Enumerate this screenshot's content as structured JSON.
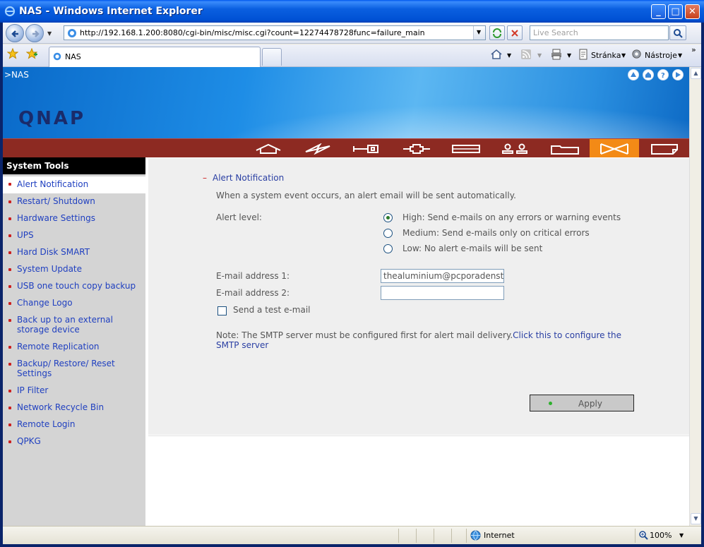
{
  "window": {
    "title": "NAS - Windows Internet Explorer"
  },
  "browser": {
    "url": "http://192.168.1.200:8080/cgi-bin/misc/misc.cgi?count=12274478728func=failure_main",
    "search_placeholder": "Live Search",
    "tab_title": "NAS",
    "page_menu": "Stránka",
    "tools_menu": "Nástroje"
  },
  "banner": {
    "breadcrumb": ">NAS",
    "logo": "QNAP"
  },
  "sidebar": {
    "title": "System Tools",
    "items": [
      "Alert Notification",
      "Restart/ Shutdown",
      "Hardware Settings",
      "UPS",
      "Hard Disk SMART",
      "System Update",
      "USB one touch copy backup",
      "Change Logo",
      "Back up to an external storage device",
      "Remote Replication",
      "Backup/ Restore/ Reset Settings",
      "IP Filter",
      "Network Recycle Bin",
      "Remote Login",
      "QPKG"
    ],
    "active_index": 0
  },
  "form": {
    "section_title": "Alert Notification",
    "description": "When a system event occurs, an alert email will be sent automatically.",
    "alert_level_label": "Alert level:",
    "alert_options": [
      "High: Send e-mails on any errors or warning events",
      "Medium: Send e-mails only on critical errors",
      "Low: No alert e-mails will be sent"
    ],
    "selected_alert": 0,
    "email1_label": "E-mail address 1:",
    "email1_value": "thealuminium@pcporadenstvi.c",
    "email2_label": "E-mail address 2:",
    "email2_value": "",
    "test_email_label": "Send a test e-mail",
    "note_text": "Note: The SMTP server must be configured first for alert mail delivery.",
    "note_link": "Click this to configure the SMTP server",
    "apply_label": "Apply"
  },
  "status": {
    "zone": "Internet",
    "zoom": "100%"
  }
}
